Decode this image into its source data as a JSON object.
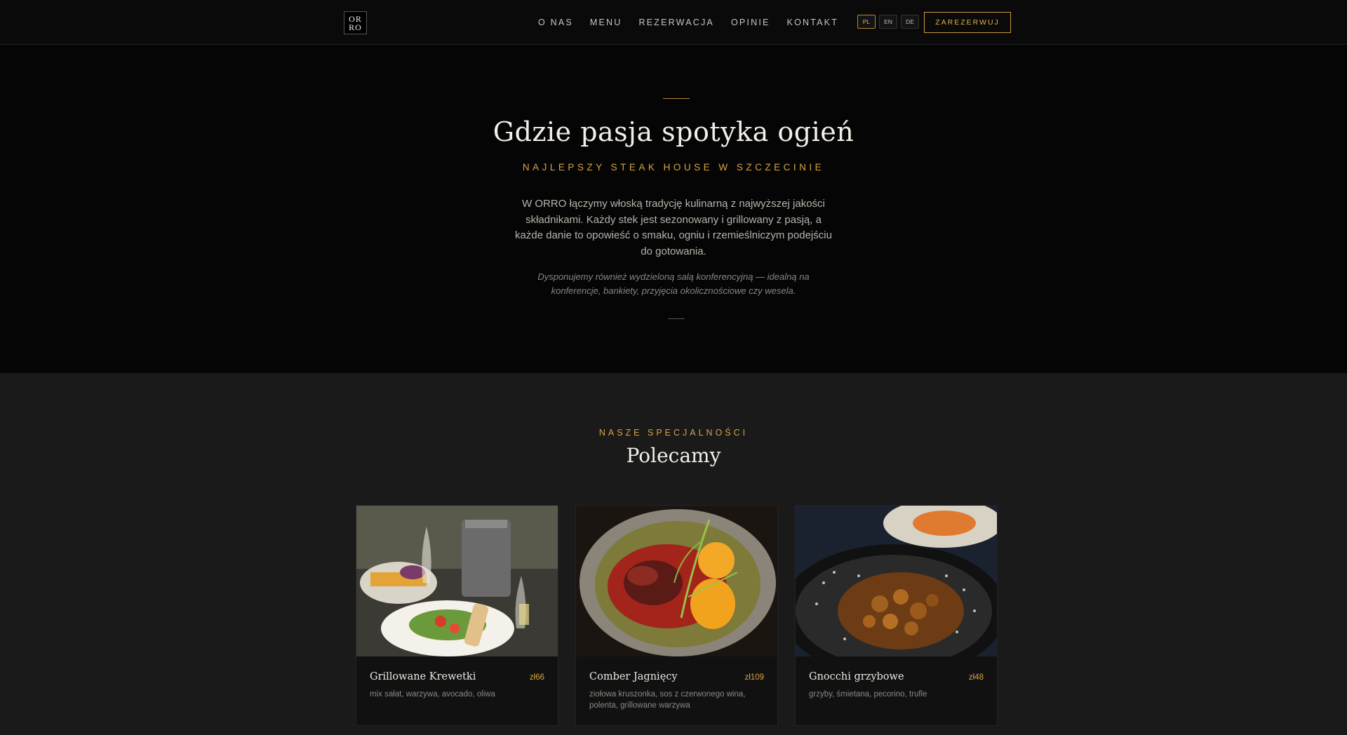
{
  "header": {
    "logo_top": "OR",
    "logo_bottom": "RO",
    "nav": [
      "O NAS",
      "MENU",
      "REZERWACJA",
      "OPINIE",
      "KONTAKT"
    ],
    "languages": [
      "PL",
      "EN",
      "DE"
    ],
    "active_language": "PL",
    "reserve_label": "ZAREZERWUJ"
  },
  "hero": {
    "title": "Gdzie pasja spotyka ogień",
    "subtitle": "NAJLEPSZY STEAK HOUSE W SZCZECINIE",
    "description": "W ORRO łączymy włoską tradycję kulinarną z najwyższej jakości składnikami. Każdy stek jest sezonowany i grillowany z pasją, a każde danie to opowieść o smaku, ogniu i rzemieślniczym podejściu do gotowania.",
    "note": "Dysponujemy również wydzieloną salą konferencyjną — idealną na konferencje, bankiety, przyjęcia okolicznościowe czy wesela."
  },
  "specials": {
    "subtitle": "NASZE SPECJALNOŚCI",
    "title": "Polecamy",
    "cards": [
      {
        "name": "Grillowane Krewetki",
        "price": "zł66",
        "desc": "mix sałat, warzywa, avocado, oliwa"
      },
      {
        "name": "Comber Jagnięcy",
        "price": "zł109",
        "desc": "ziołowa kruszonka, sos z czerwonego wina, polenta, grillowane warzywa"
      },
      {
        "name": "Gnocchi grzybowe",
        "price": "zł48",
        "desc": "grzyby, śmietana, pecorino, trufle"
      }
    ]
  },
  "colors": {
    "accent": "#d9a441",
    "background": "#1a1a1a",
    "hero_bg": "#050505"
  }
}
